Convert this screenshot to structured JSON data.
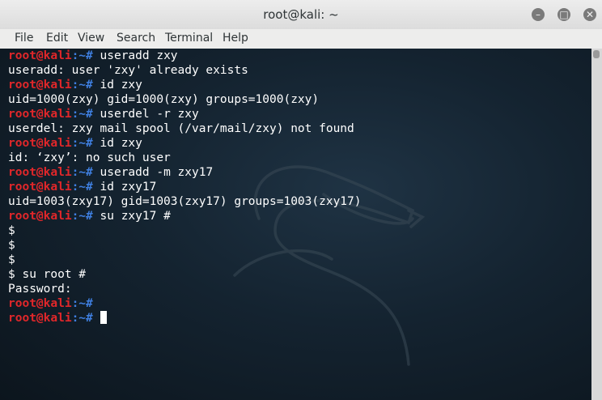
{
  "window": {
    "title": "root@kali: ~"
  },
  "menu": [
    "File",
    "Edit",
    "View",
    "Search",
    "Terminal",
    "Help"
  ],
  "prompt": {
    "user": "root@kali",
    "path": ":~#"
  },
  "lines": [
    {
      "type": "prompt",
      "cmd": " useradd zxy"
    },
    {
      "type": "out",
      "text": "useradd: user 'zxy' already exists"
    },
    {
      "type": "prompt",
      "cmd": " id zxy"
    },
    {
      "type": "out",
      "text": "uid=1000(zxy) gid=1000(zxy) groups=1000(zxy)"
    },
    {
      "type": "prompt",
      "cmd": " userdel -r zxy"
    },
    {
      "type": "out",
      "text": "userdel: zxy mail spool (/var/mail/zxy) not found"
    },
    {
      "type": "prompt",
      "cmd": " id zxy"
    },
    {
      "type": "out",
      "text": "id: ‘zxy’: no such user"
    },
    {
      "type": "prompt",
      "cmd": " useradd -m zxy17"
    },
    {
      "type": "prompt",
      "cmd": " id zxy17"
    },
    {
      "type": "out",
      "text": "uid=1003(zxy17) gid=1003(zxy17) groups=1003(zxy17)"
    },
    {
      "type": "prompt",
      "cmd": " su zxy17 #"
    },
    {
      "type": "out",
      "text": "$"
    },
    {
      "type": "out",
      "text": "$"
    },
    {
      "type": "out",
      "text": "$"
    },
    {
      "type": "out",
      "text": "$ su root #"
    },
    {
      "type": "out",
      "text": "Password:"
    },
    {
      "type": "prompt",
      "cmd": ""
    },
    {
      "type": "prompt",
      "cmd": " ",
      "cursor": true
    }
  ]
}
